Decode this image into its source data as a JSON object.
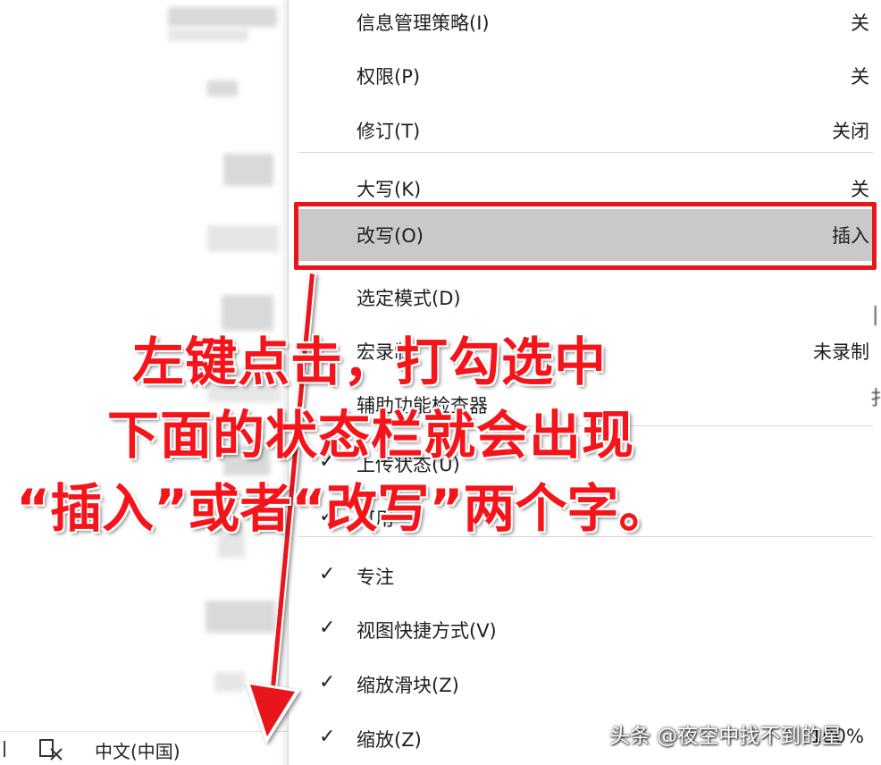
{
  "menu": {
    "items": [
      {
        "label": "信息管理策略(I)",
        "value": "关",
        "checked": false
      },
      {
        "label": "权限(P)",
        "value": "关",
        "checked": false
      },
      {
        "label": "修订(T)",
        "value": "关闭",
        "checked": false
      },
      {
        "label": "大写(K)",
        "value": "关",
        "checked": false
      },
      {
        "label": "改写(O)",
        "value": "插入",
        "checked": false,
        "highlighted": true
      },
      {
        "label": "选定模式(D)",
        "value": "",
        "checked": false
      },
      {
        "label": "宏录制",
        "value": "未录制",
        "checked": false
      },
      {
        "label": "辅助功能检查器",
        "value": "",
        "checked": false
      },
      {
        "label": "上传状态(U)",
        "value": "",
        "checked": true
      },
      {
        "label": "可用",
        "value": "",
        "checked": true
      },
      {
        "label": "专注",
        "value": "",
        "checked": true
      },
      {
        "label": "视图快捷方式(V)",
        "value": "",
        "checked": true
      },
      {
        "label": "缩放滑块(Z)",
        "value": "",
        "checked": true
      },
      {
        "label": "缩放(Z)",
        "value": "100%",
        "checked": true
      }
    ],
    "check_glyph": "✓"
  },
  "statusbar": {
    "language": "中文(中国)",
    "accessibility_icon": "accessibility-icon"
  },
  "annotation": {
    "line1": "左键点击，打勾选中",
    "line2": "下面的状态栏就会出现",
    "line3": "“插入”或者“改写”两个字。",
    "color": "#f5141a"
  },
  "watermark": "头条 @夜空中找不到的星",
  "colors": {
    "highlight_box": "#e8151b",
    "menu_highlight_bg": "#c9c9c9"
  }
}
